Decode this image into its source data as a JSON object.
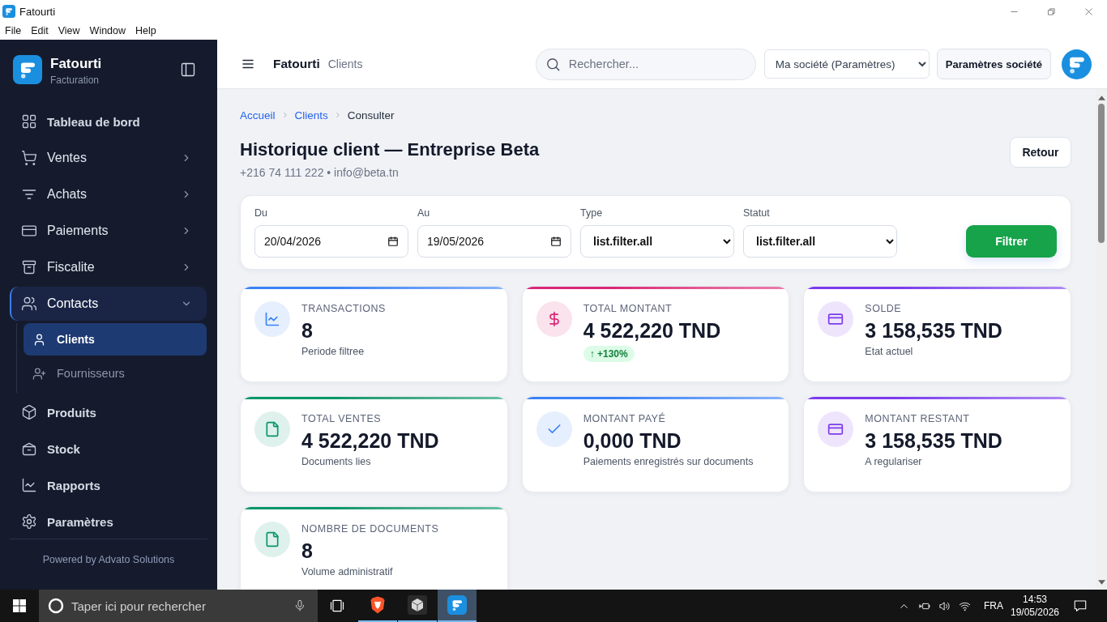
{
  "window": {
    "title": "Fatourti"
  },
  "menu_bar": [
    "File",
    "Edit",
    "View",
    "Window",
    "Help"
  ],
  "sidebar": {
    "brand": {
      "name": "Fatourti",
      "subtitle": "Facturation"
    },
    "items": [
      {
        "label": "Tableau de bord",
        "kind": "link",
        "selected": false
      },
      {
        "label": "Ventes",
        "kind": "group",
        "expanded": false,
        "selected": false
      },
      {
        "label": "Achats",
        "kind": "group",
        "expanded": false,
        "selected": false
      },
      {
        "label": "Paiements",
        "kind": "group",
        "expanded": false,
        "selected": false
      },
      {
        "label": "Fiscalite",
        "kind": "group",
        "expanded": false,
        "selected": false
      },
      {
        "label": "Contacts",
        "kind": "group",
        "expanded": true,
        "selected": false,
        "children": [
          {
            "label": "Clients",
            "selected": true
          },
          {
            "label": "Fournisseurs",
            "selected": false
          }
        ]
      },
      {
        "label": "Produits",
        "kind": "link",
        "selected": false
      },
      {
        "label": "Stock",
        "kind": "link",
        "selected": false
      },
      {
        "label": "Rapports",
        "kind": "link",
        "selected": false
      },
      {
        "label": "Paramètres",
        "kind": "link",
        "selected": false
      }
    ],
    "footer": "Powered by Advato Solutions"
  },
  "header": {
    "app_name": "Fatourti",
    "section": "Clients",
    "search": {
      "placeholder": "Rechercher..."
    },
    "company_select": "Ma société (Paramètres)",
    "settings_button": "Paramètres société"
  },
  "breadcrumb": [
    {
      "label": "Accueil",
      "kind": "link"
    },
    {
      "label": "Clients",
      "kind": "link"
    },
    {
      "label": "Consulter",
      "kind": "current"
    }
  ],
  "page": {
    "title": "Historique client — Entreprise Beta",
    "subtitle": "+216 74 111 222 • info@beta.tn",
    "back_button": "Retour"
  },
  "filters": {
    "fields": [
      {
        "label": "Du",
        "kind": "date",
        "value": "20/04/2026"
      },
      {
        "label": "Au",
        "kind": "date",
        "value": "19/05/2026"
      },
      {
        "label": "Type",
        "kind": "select",
        "value": "list.filter.all"
      },
      {
        "label": "Statut",
        "kind": "select",
        "value": "list.filter.all"
      }
    ],
    "button": "Filtrer"
  },
  "stats": [
    {
      "label": "TRANSACTIONS",
      "value": "8",
      "note": "Periode filtree",
      "color": "#3b82f6"
    },
    {
      "label": "TOTAL MONTANT",
      "value": "4 522,220 TND",
      "badge": "↑ +130%",
      "color": "#db2777"
    },
    {
      "label": "SOLDE",
      "value": "3 158,535 TND",
      "note": "Etat actuel",
      "color": "#7c3aed"
    },
    {
      "label": "TOTAL VENTES",
      "value": "4 522,220 TND",
      "note": "Documents lies",
      "color": "#059669"
    },
    {
      "label": "MONTANT PAYÉ",
      "value": "0,000 TND",
      "note": "Paiements enregistrés sur documents",
      "color": "#3b82f6"
    },
    {
      "label": "MONTANT RESTANT",
      "value": "3 158,535 TND",
      "note": "A regulariser",
      "color": "#7c3aed"
    },
    {
      "label": "NOMBRE DE DOCUMENTS",
      "value": "8",
      "note": "Volume administratif",
      "color": "#059669"
    }
  ],
  "taskbar": {
    "search": {
      "placeholder": "Taper ici pour rechercher"
    },
    "apps": [
      {
        "running": true,
        "selected": false
      },
      {
        "running": true,
        "selected": false
      },
      {
        "running": true,
        "selected": true
      }
    ],
    "language": "FRA",
    "time": "14:53",
    "date": "19/05/2026"
  }
}
